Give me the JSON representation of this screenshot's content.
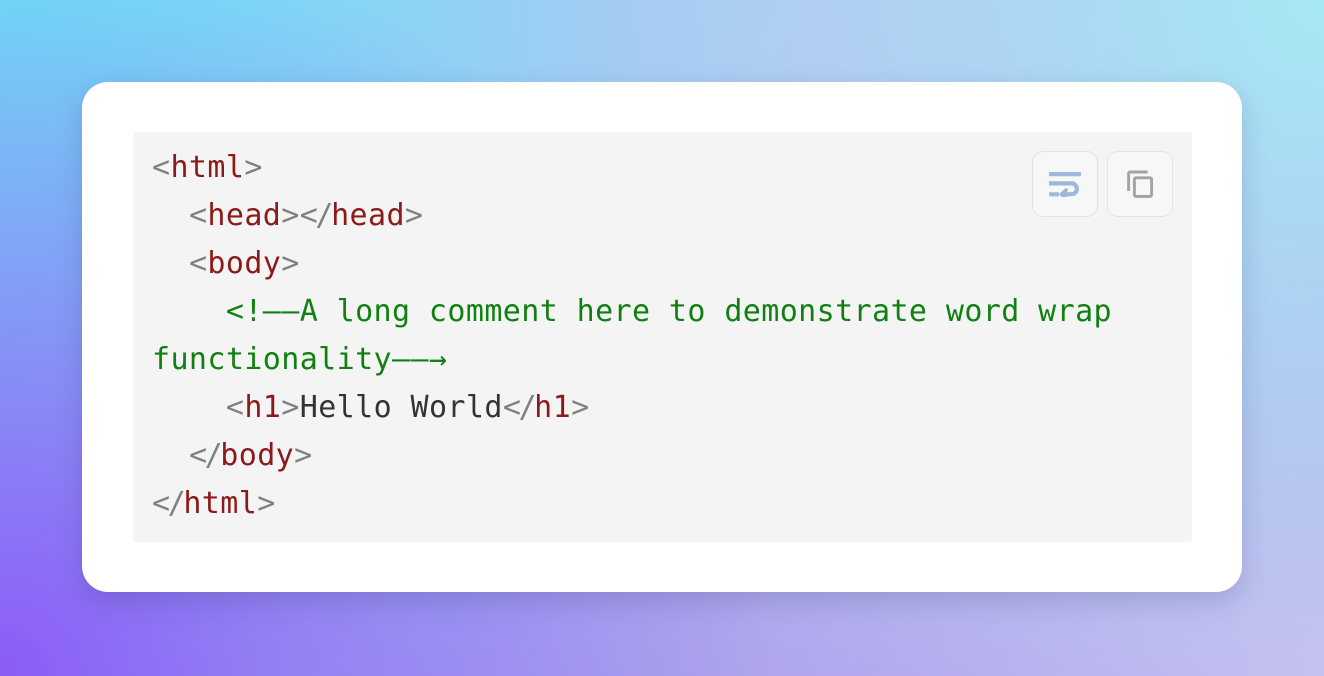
{
  "background": {
    "colors": [
      "#7fe2f4",
      "#a8e8f5",
      "#b9bdf0",
      "#cdb6ef",
      "#8b5cf6"
    ]
  },
  "card": {
    "background": "#ffffff"
  },
  "code_block": {
    "background": "#f4f4f4",
    "language": "html",
    "word_wrap_enabled": true,
    "toolbar": {
      "wrap_button": {
        "icon": "word-wrap-icon",
        "label": "Toggle word wrap",
        "active": true,
        "color": "#9cb8da"
      },
      "copy_button": {
        "icon": "copy-icon",
        "label": "Copy code",
        "active": false,
        "color": "#a3a3a3"
      }
    },
    "colors": {
      "punctuation": "#808080",
      "tag": "#8b1a1a",
      "text": "#333333",
      "comment": "#118012"
    },
    "lines": [
      {
        "indent": 0,
        "tokens": [
          {
            "type": "punct",
            "text": "<"
          },
          {
            "type": "tag",
            "text": "html"
          },
          {
            "type": "punct",
            "text": ">"
          }
        ]
      },
      {
        "indent": 2,
        "tokens": [
          {
            "type": "punct",
            "text": "<"
          },
          {
            "type": "tag",
            "text": "head"
          },
          {
            "type": "punct",
            "text": ">"
          },
          {
            "type": "punct",
            "text": "</"
          },
          {
            "type": "tag",
            "text": "head"
          },
          {
            "type": "punct",
            "text": ">"
          }
        ]
      },
      {
        "indent": 2,
        "tokens": [
          {
            "type": "punct",
            "text": "<"
          },
          {
            "type": "tag",
            "text": "body"
          },
          {
            "type": "punct",
            "text": ">"
          }
        ]
      },
      {
        "indent": 4,
        "tokens": [
          {
            "type": "comment",
            "text": "<!--A long comment here to demonstrate word wrap functionality-->"
          }
        ]
      },
      {
        "indent": 4,
        "tokens": [
          {
            "type": "punct",
            "text": "<"
          },
          {
            "type": "tag",
            "text": "h1"
          },
          {
            "type": "punct",
            "text": ">"
          },
          {
            "type": "text",
            "text": "Hello World"
          },
          {
            "type": "punct",
            "text": "</"
          },
          {
            "type": "tag",
            "text": "h1"
          },
          {
            "type": "punct",
            "text": ">"
          }
        ]
      },
      {
        "indent": 2,
        "tokens": [
          {
            "type": "punct",
            "text": "</"
          },
          {
            "type": "tag",
            "text": "body"
          },
          {
            "type": "punct",
            "text": ">"
          }
        ]
      },
      {
        "indent": 0,
        "tokens": [
          {
            "type": "punct",
            "text": "</"
          },
          {
            "type": "tag",
            "text": "html"
          },
          {
            "type": "punct",
            "text": ">"
          }
        ]
      }
    ]
  }
}
